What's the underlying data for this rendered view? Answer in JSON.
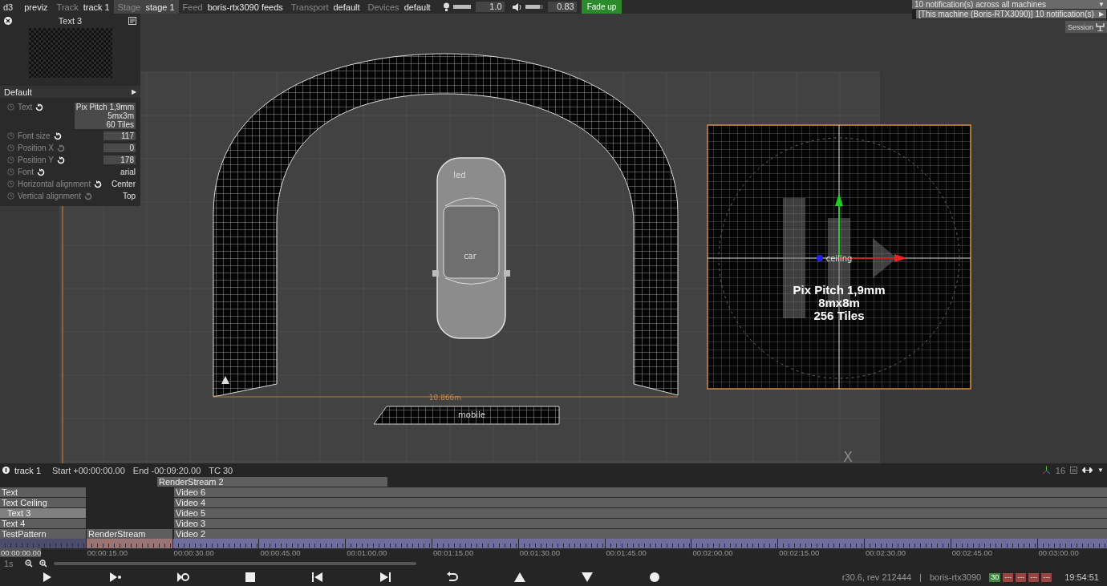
{
  "top_bar": {
    "app": "d3",
    "mode": "previz",
    "fields": [
      {
        "label": "Track",
        "value": "track 1",
        "selected": false
      },
      {
        "label": "Stage",
        "value": "stage 1",
        "selected": true
      },
      {
        "label": "Feed",
        "value": "boris-rtx3090 feeds",
        "selected": false
      },
      {
        "label": "Transport",
        "value": "default",
        "selected": false
      },
      {
        "label": "Devices",
        "value": "default",
        "selected": false
      }
    ],
    "brightness": {
      "level": 1.0,
      "value": "1.0"
    },
    "volume": {
      "level": 0.83,
      "value": "0.83"
    },
    "fade_button": "Fade up"
  },
  "notifications": {
    "summary": "10 notification(s) across all machines",
    "toggle": "▼",
    "items": [
      {
        "text": "[This machine (Boris-RTX3090)] 10 notification(s)",
        "arrow": "▶"
      }
    ]
  },
  "session_button": "Session",
  "layer_panel": {
    "title": "Text 3",
    "section": "Default",
    "section_arrow": "▶",
    "properties": [
      {
        "label": "Text",
        "modified": true,
        "kind": "field",
        "value": "Pix Pitch 1,9mm\n5mx3m\n60 Tiles"
      },
      {
        "label": "Font size",
        "modified": true,
        "kind": "field",
        "value": "117"
      },
      {
        "label": "Position X",
        "modified": false,
        "kind": "field",
        "value": "0"
      },
      {
        "label": "Position Y",
        "modified": true,
        "kind": "field",
        "value": "178"
      },
      {
        "label": "Font",
        "modified": true,
        "kind": "text",
        "value": "arial"
      },
      {
        "label": "Horizontal alignment",
        "modified": true,
        "kind": "text",
        "value": "Center"
      },
      {
        "label": "Vertical alignment",
        "modified": false,
        "kind": "text",
        "value": "Top"
      }
    ]
  },
  "scene": {
    "labels": [
      "led",
      "car",
      "10.866m",
      "mobile",
      "ceiling",
      "X"
    ],
    "screen_text": [
      "Pix Pitch 1,9mm",
      "8mx8m",
      "256 Tiles"
    ]
  },
  "timeline": {
    "track": "track 1",
    "start": "Start +00:00:00.00",
    "end": "End -00:09:20.00",
    "tc": "TC 30",
    "count": "16",
    "menu": "▼",
    "layer_rows": [
      [
        {
          "name": "RenderStream 2",
          "kind": "span",
          "selected": false
        }
      ],
      [
        {
          "name": "Text",
          "kind": "left",
          "selected": false
        },
        {
          "name": "Video 6",
          "kind": "right",
          "selected": false
        }
      ],
      [
        {
          "name": "Text Ceiling",
          "kind": "left",
          "selected": false
        },
        {
          "name": "Video 4",
          "kind": "right",
          "selected": false
        }
      ],
      [
        {
          "name": "Text 3",
          "kind": "left",
          "selected": true
        },
        {
          "name": "Video 5",
          "kind": "right",
          "selected": false
        }
      ],
      [
        {
          "name": "Text 4",
          "kind": "left",
          "selected": false
        },
        {
          "name": "Video 3",
          "kind": "right",
          "selected": false
        }
      ],
      [
        {
          "name": "TestPattern",
          "kind": "left",
          "selected": false
        },
        {
          "name": "RenderStream",
          "kind": "middle",
          "selected": false
        },
        {
          "name": "Video 2",
          "kind": "right",
          "selected": false
        }
      ]
    ],
    "ruler": [
      {
        "label": "00:00:00.00",
        "color": "#4a4d6c",
        "selected": true
      },
      {
        "label": "00:00:15.00",
        "color": "#9a7373",
        "selected": false
      },
      {
        "label": "00:00:30.00",
        "color": "#6e6e9e",
        "selected": false
      },
      {
        "label": "00:00:45.00",
        "color": "#6e6e9e",
        "selected": false
      },
      {
        "label": "00:01:00.00",
        "color": "#6e6e9e",
        "selected": false
      },
      {
        "label": "00:01:15.00",
        "color": "#6e6e9e",
        "selected": false
      },
      {
        "label": "00:01:30.00",
        "color": "#6e6e9e",
        "selected": false
      },
      {
        "label": "00:01:45.00",
        "color": "#6e6e9e",
        "selected": false
      },
      {
        "label": "00:02:00.00",
        "color": "#6e6e9e",
        "selected": false
      },
      {
        "label": "00:02:15.00",
        "color": "#6e6e9e",
        "selected": false
      },
      {
        "label": "00:02:30.00",
        "color": "#6e6e9e",
        "selected": false
      },
      {
        "label": "00:02:45.00",
        "color": "#6e6e9e",
        "selected": false
      },
      {
        "label": "00:03:00.00",
        "color": "#6e6e9e",
        "selected": false
      }
    ],
    "zoom_label": "1s",
    "status": {
      "version": "r30.6, rev 212444",
      "separator": "|",
      "machine": "boris-rtx3090",
      "badges": [
        {
          "text": "30",
          "kind": "ok"
        },
        {
          "text": "---",
          "kind": "error"
        },
        {
          "text": "---",
          "kind": "error"
        },
        {
          "text": "---",
          "kind": "error"
        },
        {
          "text": "---",
          "kind": "error"
        }
      ],
      "clock": "19:54:51"
    }
  }
}
